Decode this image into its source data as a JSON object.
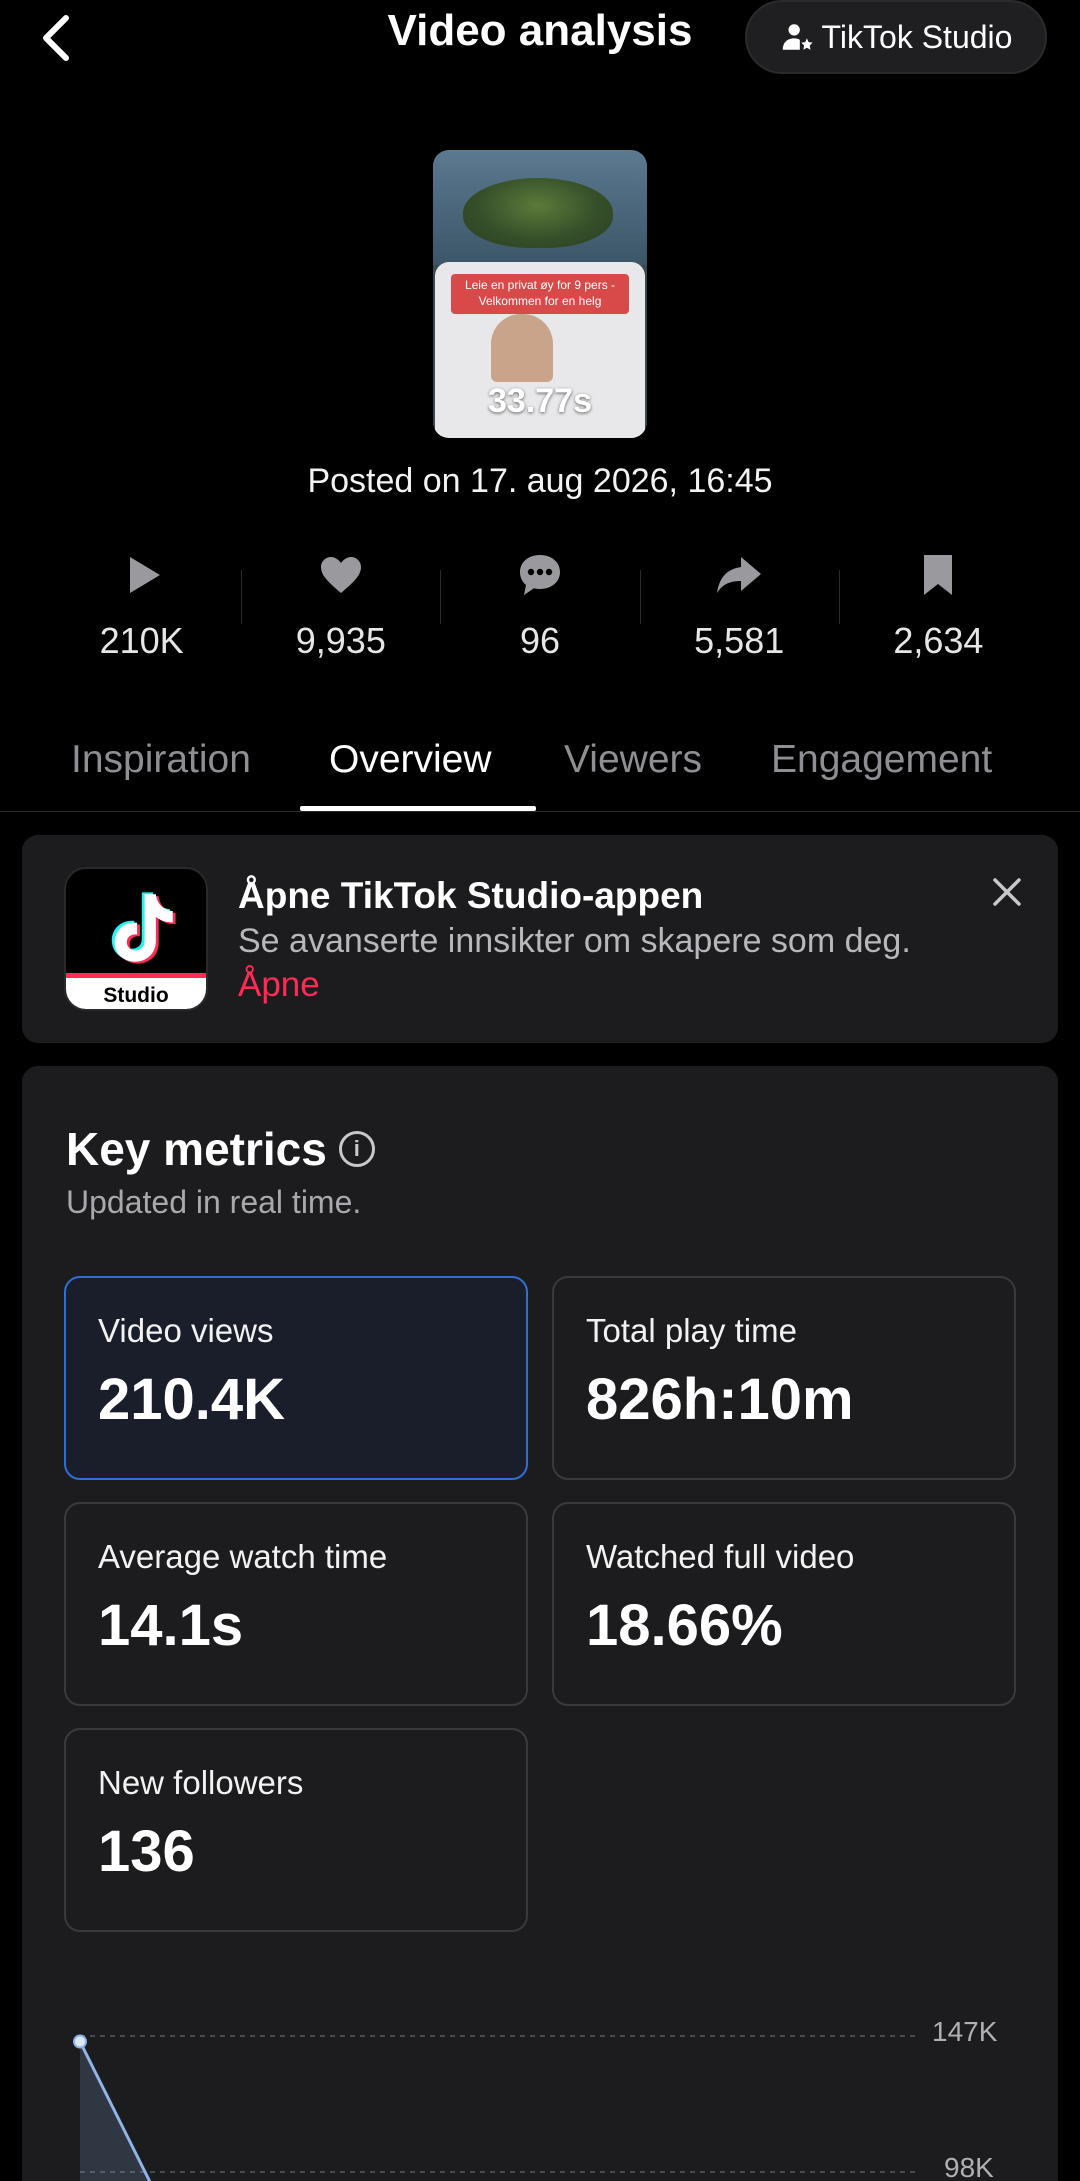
{
  "header": {
    "title": "Video analysis",
    "studio_button": "TikTok Studio"
  },
  "video": {
    "thumbnail_banner": "Leie en privat øy for 9 pers -Velkommen for en helg",
    "duration": "33.77s",
    "posted": "Posted on 17. aug 2026, 16:45"
  },
  "stats": {
    "views": "210K",
    "likes": "9,935",
    "comments": "96",
    "shares": "5,581",
    "saves": "2,634"
  },
  "tabs": [
    "Inspiration",
    "Overview",
    "Viewers",
    "Engagement"
  ],
  "active_tab": "Overview",
  "promo": {
    "icon_label": "Studio",
    "title": "Åpne TikTok Studio-appen",
    "subtitle": "Se avanserte innsikter om skapere som deg.",
    "link": "Åpne"
  },
  "key_metrics": {
    "title": "Key metrics",
    "subtitle": "Updated in real time.",
    "cards": [
      {
        "label": "Video views",
        "value": "210.4K"
      },
      {
        "label": "Total play time",
        "value": "826h:10m"
      },
      {
        "label": "Average watch time",
        "value": "14.1s"
      },
      {
        "label": "Watched full video",
        "value": "18.66%"
      },
      {
        "label": "New followers",
        "value": "136"
      }
    ]
  },
  "chart_data": {
    "type": "line",
    "y_ticks": [
      "147K",
      "98K"
    ],
    "series": [
      {
        "values": [
          145000,
          90000
        ]
      }
    ],
    "color": "#8fb4e8"
  },
  "colors": {
    "accent": "#fe2c55",
    "selected_border": "#2f6fd6"
  }
}
